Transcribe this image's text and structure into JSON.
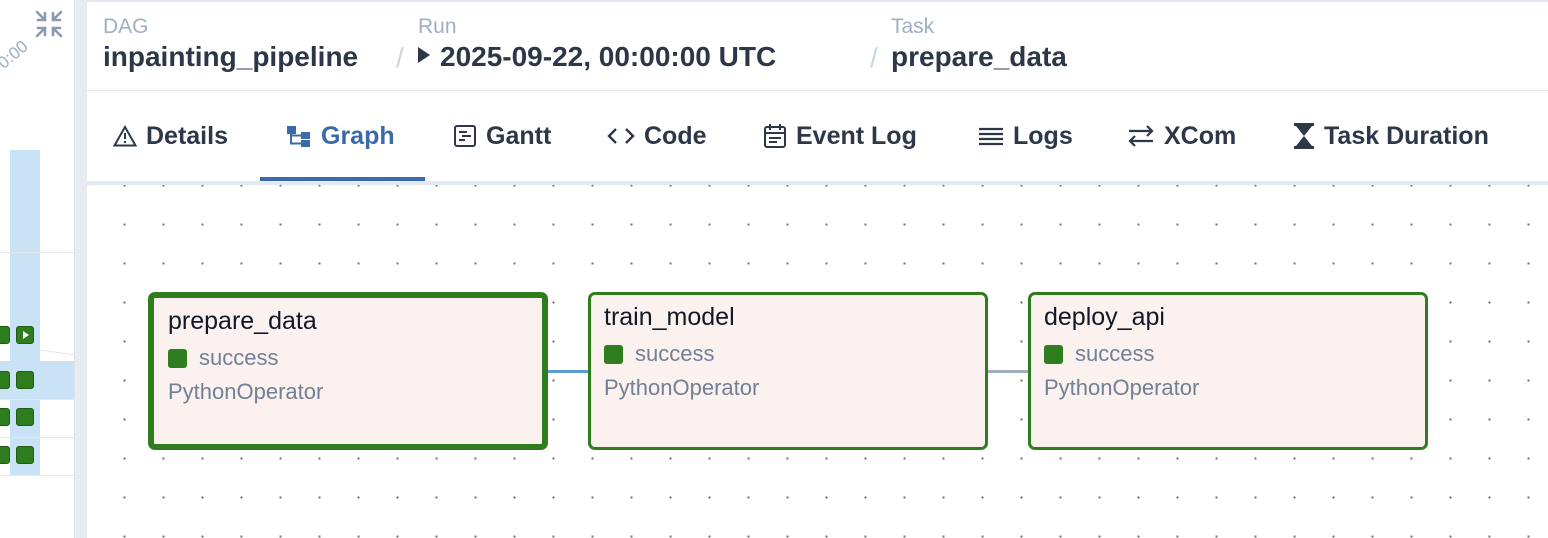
{
  "left_grid": {
    "time_label": "0:00"
  },
  "breadcrumb": {
    "dag": {
      "label": "DAG",
      "value": "inpainting_pipeline"
    },
    "run": {
      "label": "Run",
      "value": "2025-09-22, 00:00:00 UTC"
    },
    "task": {
      "label": "Task",
      "value": "prepare_data"
    },
    "separator": "/"
  },
  "tabs": [
    {
      "label": "Details",
      "icon": "warning-triangle-icon",
      "active": false
    },
    {
      "label": "Graph",
      "icon": "graph-icon",
      "active": true
    },
    {
      "label": "Gantt",
      "icon": "gantt-icon",
      "active": false
    },
    {
      "label": "Code",
      "icon": "code-icon",
      "active": false
    },
    {
      "label": "Event Log",
      "icon": "calendar-icon",
      "active": false
    },
    {
      "label": "Logs",
      "icon": "list-icon",
      "active": false
    },
    {
      "label": "XCom",
      "icon": "exchange-arrows-icon",
      "active": false
    },
    {
      "label": "Task Duration",
      "icon": "hourglass-icon",
      "active": false
    }
  ],
  "graph": {
    "nodes": [
      {
        "id": "prepare_data",
        "title": "prepare_data",
        "state": "success",
        "operator": "PythonOperator",
        "selected": true
      },
      {
        "id": "train_model",
        "title": "train_model",
        "state": "success",
        "operator": "PythonOperator",
        "selected": false
      },
      {
        "id": "deploy_api",
        "title": "deploy_api",
        "state": "success",
        "operator": "PythonOperator",
        "selected": false
      }
    ]
  },
  "colors": {
    "success": "#2e7d1f",
    "active_tab": "#3a6ba8",
    "node_bg": "#fbf1ee",
    "highlight": "#c9e2f6",
    "edge_selected": "#5b9bd5",
    "edge_default": "#a0aec0"
  }
}
